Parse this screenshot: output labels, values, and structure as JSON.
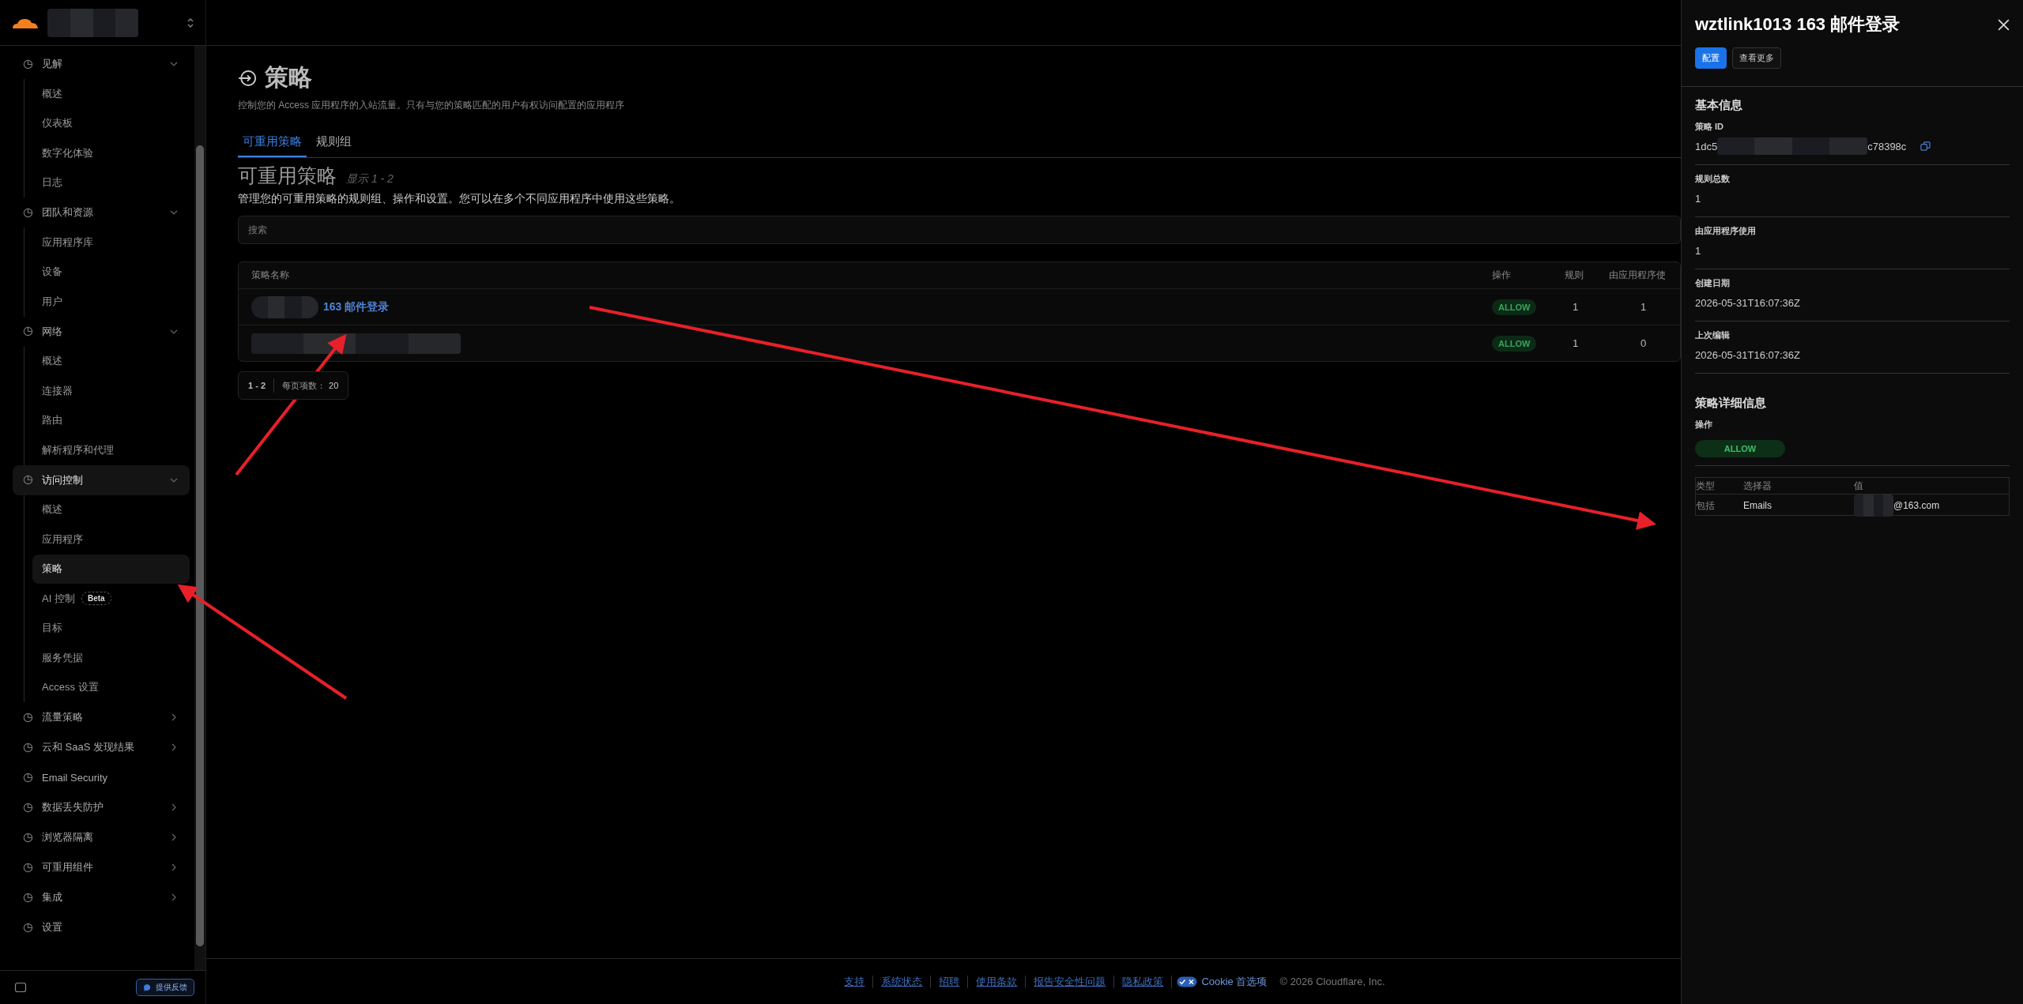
{
  "sidebar": {
    "groups": [
      {
        "label": "见解",
        "expanded": true,
        "active": false,
        "children": [
          {
            "label": "概述",
            "selected": false
          },
          {
            "label": "仪表板",
            "selected": false
          },
          {
            "label": "数字化体验",
            "selected": false
          },
          {
            "label": "日志",
            "selected": false
          }
        ]
      },
      {
        "label": "团队和资源",
        "expanded": true,
        "active": false,
        "children": [
          {
            "label": "应用程序库",
            "selected": false
          },
          {
            "label": "设备",
            "selected": false
          },
          {
            "label": "用户",
            "selected": false
          }
        ]
      },
      {
        "label": "网络",
        "expanded": true,
        "active": false,
        "children": [
          {
            "label": "概述",
            "selected": false
          },
          {
            "label": "连接器",
            "selected": false
          },
          {
            "label": "路由",
            "selected": false
          },
          {
            "label": "解析程序和代理",
            "selected": false
          }
        ]
      },
      {
        "label": "访问控制",
        "expanded": true,
        "active": true,
        "children": [
          {
            "label": "概述",
            "selected": false
          },
          {
            "label": "应用程序",
            "selected": false
          },
          {
            "label": "策略",
            "selected": true
          },
          {
            "label": "AI 控制",
            "badge": "Beta",
            "selected": false
          },
          {
            "label": "目标",
            "selected": false
          },
          {
            "label": "服务凭据",
            "selected": false
          },
          {
            "label": "Access 设置",
            "selected": false
          }
        ]
      },
      {
        "label": "流量策略",
        "expanded": false,
        "active": false
      },
      {
        "label": "云和 SaaS 发现结果",
        "expanded": false,
        "active": false
      },
      {
        "label": "Email Security",
        "active": false
      },
      {
        "label": "数据丢失防护",
        "expanded": false,
        "active": false
      },
      {
        "label": "浏览器隔离",
        "expanded": false,
        "active": false
      },
      {
        "label": "可重用组件",
        "expanded": false,
        "active": false
      },
      {
        "label": "集成",
        "expanded": false,
        "active": false
      },
      {
        "label": "设置",
        "active": false
      }
    ],
    "feedback_button": "提供反馈"
  },
  "page": {
    "title": "策略",
    "description": "控制您的 Access 应用程序的入站流量。只有与您的策略匹配的用户有权访问配置的应用程序",
    "tabs": [
      {
        "label": "可重用策略",
        "selected": true
      },
      {
        "label": "规则组",
        "selected": false
      }
    ],
    "section_title": "可重用策略",
    "section_count": "显示 1 - 2",
    "section_description": "管理您的可重用策略的规则组、操作和设置。您可以在多个不同应用程序中使用这些策略。",
    "search": {
      "placeholder": "搜索"
    },
    "table": {
      "columns": [
        "策略名称",
        "操作",
        "规则",
        "由应用程序使"
      ],
      "rows": [
        {
          "name": "163 邮件登录",
          "action": "ALLOW",
          "rules": "1",
          "used_by_apps": "1"
        },
        {
          "action": "ALLOW",
          "rules": "1",
          "used_by_apps": "0"
        }
      ]
    },
    "pagination": {
      "range": "1 - 2",
      "per_page_label": "每页项数：",
      "per_page": "20"
    }
  },
  "footer": {
    "links": [
      "支持",
      "系统状态",
      "招聘",
      "使用条款",
      "报告安全性问题",
      "隐私政策"
    ],
    "cookie": "Cookie 首选项",
    "copyright": "© 2026 Cloudflare, Inc."
  },
  "drawer": {
    "title": "wztlink1013 163 邮件登录",
    "buttons": [
      {
        "label": "配置",
        "kind": "primary"
      },
      {
        "label": "查看更多",
        "kind": "secondary"
      }
    ],
    "basic_title": "基本信息",
    "fields": [
      {
        "label": "策略 ID",
        "value_parts": [
          "1dc5",
          "c78398c"
        ],
        "copyable": true
      },
      {
        "label": "规则总数",
        "value_parts": [
          "1"
        ]
      },
      {
        "label": "由应用程序使用",
        "value_parts": [
          "1"
        ]
      },
      {
        "label": "创建日期",
        "value_parts": [
          "2026-05-31T16:07:36Z"
        ]
      },
      {
        "label": "上次编辑",
        "value_parts": [
          "2026-05-31T16:07:36Z"
        ]
      }
    ],
    "details_title": "策略详细信息",
    "action_label": "操作",
    "action": "ALLOW",
    "rules": {
      "columns": [
        "类型",
        "选择器",
        "值"
      ],
      "rows": [
        {
          "type": "包括",
          "selector": "Emails",
          "value": "@163.com"
        }
      ]
    }
  }
}
